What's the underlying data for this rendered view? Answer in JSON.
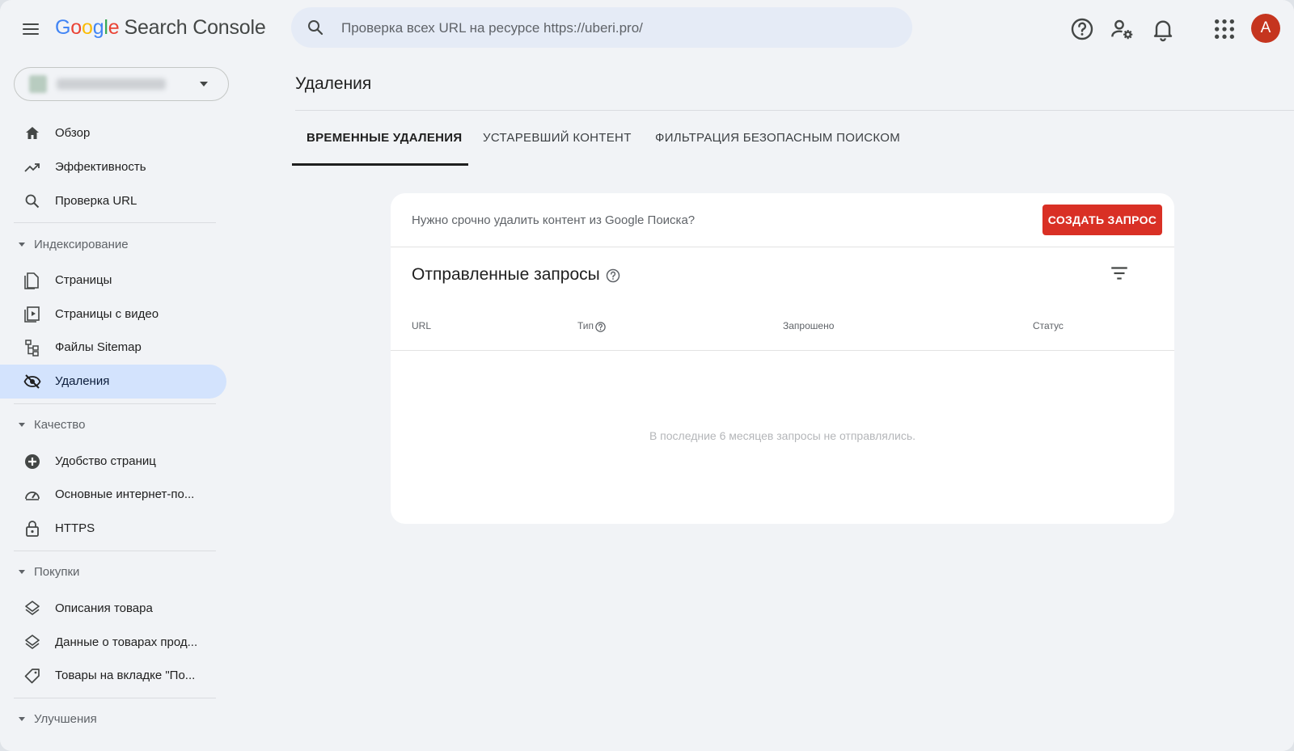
{
  "app": {
    "logo_letters": [
      "G",
      "o",
      "o",
      "g",
      "l",
      "e"
    ],
    "product_name": "Search Console",
    "avatar_letter": "A"
  },
  "colors": {
    "google_blue": "#4285f4",
    "google_red": "#ea4335",
    "google_yellow": "#fbbc05",
    "google_green": "#34a853",
    "active_nav_bg": "#d3e3fd",
    "primary_button": "#d93025",
    "avatar_bg": "#c5351f"
  },
  "search": {
    "placeholder": "Проверка всех URL на ресурсе https://uberi.pro/",
    "value": ""
  },
  "topbar_icons": [
    "menu-icon",
    "search-icon",
    "help-icon",
    "settings-account-icon",
    "notifications-bell-icon",
    "apps-grid-icon"
  ],
  "sidebar": {
    "items_top": [
      {
        "label": "Обзор",
        "icon": "home-icon"
      },
      {
        "label": "Эффективность",
        "icon": "trending-up-icon"
      },
      {
        "label": "Проверка URL",
        "icon": "search-icon"
      }
    ],
    "sections": [
      {
        "title": "Индексирование",
        "items": [
          {
            "label": "Страницы",
            "icon": "pages-icon"
          },
          {
            "label": "Страницы с видео",
            "icon": "video-pages-icon"
          },
          {
            "label": "Файлы Sitemap",
            "icon": "sitemap-icon"
          },
          {
            "label": "Удаления",
            "icon": "visibility-off-icon",
            "active": true
          }
        ]
      },
      {
        "title": "Качество",
        "items": [
          {
            "label": "Удобство страниц",
            "icon": "page-experience-icon"
          },
          {
            "label": "Основные интернет-по...",
            "icon": "speed-gauge-icon"
          },
          {
            "label": "HTTPS",
            "icon": "lock-icon"
          }
        ]
      },
      {
        "title": "Покупки",
        "items": [
          {
            "label": "Описания товара",
            "icon": "layers-icon"
          },
          {
            "label": "Данные о товарах прод...",
            "icon": "layers-icon"
          },
          {
            "label": "Товары на вкладке \"По...",
            "icon": "tag-icon"
          }
        ]
      },
      {
        "title": "Улучшения",
        "items": []
      }
    ]
  },
  "main": {
    "page_title": "Удаления",
    "tabs": [
      {
        "label": "ВРЕМЕННЫЕ УДАЛЕНИЯ",
        "active": true
      },
      {
        "label": "УСТАРЕВШИЙ КОНТЕНТ",
        "active": false
      },
      {
        "label": "ФИЛЬТРАЦИЯ БЕЗОПАСНЫМ ПОИСКОМ",
        "active": false
      }
    ],
    "card": {
      "notice": "Нужно срочно удалить контент из Google Поиска?",
      "create_button": "СОЗДАТЬ ЗАПРОС",
      "sent_title": "Отправленные запросы",
      "columns": [
        "URL",
        "Тип",
        "Запрошено",
        "Статус"
      ],
      "empty_message": "В последние 6 месяцев запросы не отправлялись."
    }
  }
}
